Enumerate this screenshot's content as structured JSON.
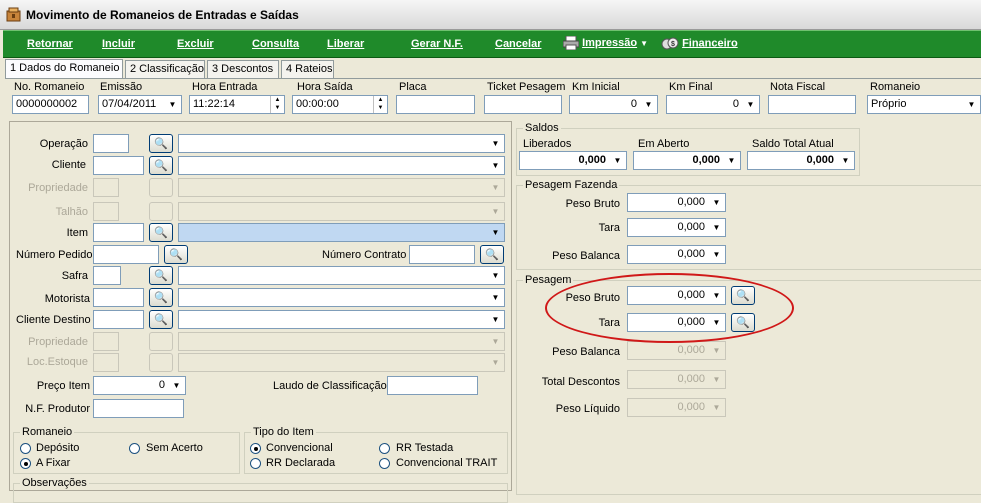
{
  "window": {
    "title": "Movimento de Romaneios de Entradas e Saídas"
  },
  "toolbar": {
    "retornar": "Retornar",
    "incluir": "Incluir",
    "excluir": "Excluir",
    "consulta": "Consulta",
    "liberar": "Liberar",
    "gerar_nf": "Gerar N.F.",
    "cancelar": "Cancelar",
    "impressao": "Impressão",
    "financeiro": "Financeiro"
  },
  "tabs": [
    {
      "label": "1 Dados do Romaneio"
    },
    {
      "label": "2 Classificação"
    },
    {
      "label": "3 Descontos"
    },
    {
      "label": "4 Rateios"
    }
  ],
  "header": {
    "no_romaneio": {
      "label": "No. Romaneio",
      "value": "0000000002"
    },
    "emissao": {
      "label": "Emissão",
      "value": "07/04/2011"
    },
    "hora_entrada": {
      "label": "Hora Entrada",
      "value": "11:22:14"
    },
    "hora_saida": {
      "label": "Hora Saída",
      "value": "00:00:00"
    },
    "placa": {
      "label": "Placa",
      "value": ""
    },
    "ticket": {
      "label": "Ticket Pesagem",
      "value": ""
    },
    "km_inicial": {
      "label": "Km Inicial",
      "value": "0"
    },
    "km_final": {
      "label": "Km Final",
      "value": "0"
    },
    "nota_fiscal": {
      "label": "Nota Fiscal",
      "value": ""
    },
    "romaneio": {
      "label": "Romaneio",
      "value": "Próprio"
    }
  },
  "form": {
    "operacao": "Operação",
    "cliente": "Cliente",
    "propriedade": "Propriedade",
    "talhao": "Talhão",
    "item": "Item",
    "numero_pedido": "Número Pedido",
    "numero_contrato": "Número Contrato",
    "safra": "Safra",
    "motorista": "Motorista",
    "cliente_destino": "Cliente Destino",
    "propriedade2": "Propriedade",
    "loc_estoque": "Loc.Estoque",
    "preco_item": "Preço Item",
    "preco_item_value": "0",
    "laudo": "Laudo de Classificação",
    "nf_produtor": "N.F. Produtor"
  },
  "romaneio_group": {
    "title": "Romaneio",
    "options": [
      "Depósito",
      "Sem Acerto",
      "A Fixar"
    ],
    "selected": "A Fixar"
  },
  "tipo_item_group": {
    "title": "Tipo do Item",
    "options": [
      "Convencional",
      "RR Testada",
      "RR Declarada",
      "Convencional TRAIT"
    ],
    "selected": "Convencional"
  },
  "observacoes": "Observações",
  "saldos": {
    "title": "Saldos",
    "liberados": {
      "label": "Liberados",
      "value": "0,000"
    },
    "em_aberto": {
      "label": "Em Aberto",
      "value": "0,000"
    },
    "saldo_total": {
      "label": "Saldo Total Atual",
      "value": "0,000"
    }
  },
  "pesagem_fazenda": {
    "title": "Pesagem Fazenda",
    "peso_bruto": {
      "label": "Peso Bruto",
      "value": "0,000"
    },
    "tara": {
      "label": "Tara",
      "value": "0,000"
    },
    "peso_balanca": {
      "label": "Peso Balanca",
      "value": "0,000"
    }
  },
  "pesagem": {
    "title": "Pesagem",
    "peso_bruto": {
      "label": "Peso Bruto",
      "value": "0,000"
    },
    "tara": {
      "label": "Tara",
      "value": "0,000"
    },
    "peso_balanca": {
      "label": "Peso Balanca",
      "value": "0,000"
    },
    "total_descontos": {
      "label": "Total Descontos",
      "value": "0,000"
    },
    "peso_liquido": {
      "label": "Peso Líquido",
      "value": "0,000"
    }
  },
  "colors": {
    "toolbar": "#1f8a2a",
    "highlight": "#d01818",
    "selected_field": "#c0d8f2"
  }
}
